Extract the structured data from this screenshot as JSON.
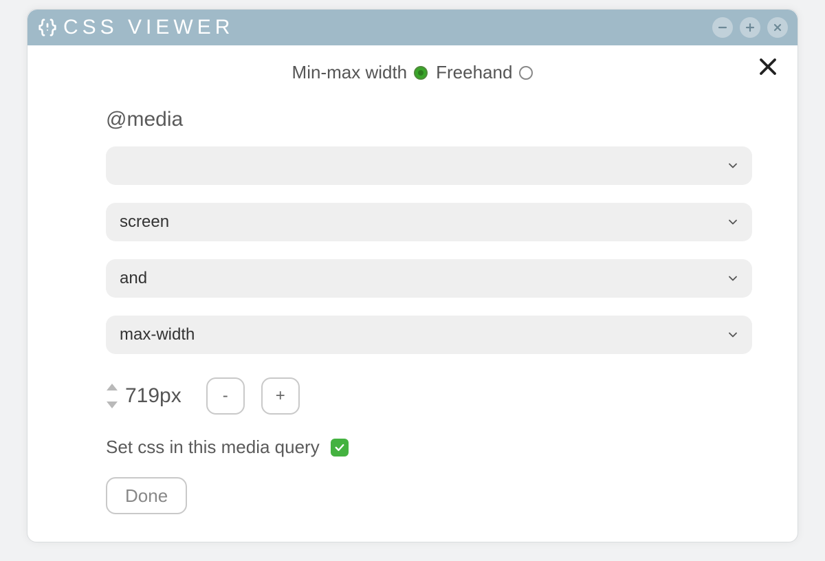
{
  "colors": {
    "titlebar_bg": "#a0bac8",
    "accent_green": "#3aa62a",
    "checkbox_green": "#44b240"
  },
  "titlebar": {
    "title": "CSS VIEWER"
  },
  "mode": {
    "option1_label": "Min-max width",
    "option1_selected": true,
    "option2_label": "Freehand",
    "option2_selected": false
  },
  "section_label": "@media",
  "dropdowns": [
    {
      "value": ""
    },
    {
      "value": "screen"
    },
    {
      "value": "and"
    },
    {
      "value": "max-width"
    }
  ],
  "width_value": "719px",
  "stepper": {
    "minus_label": "-",
    "plus_label": "+"
  },
  "set_css_label": "Set css in this media query",
  "set_css_checked": true,
  "done_label": "Done"
}
